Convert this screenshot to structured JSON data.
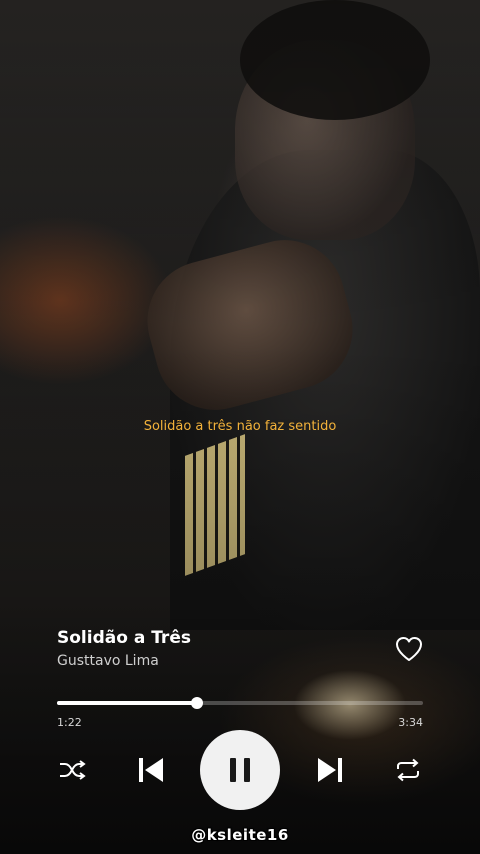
{
  "lyrics": {
    "current_line": "Solidão a três não faz sentido"
  },
  "track": {
    "title": "Solidão a Três",
    "artist": "Gusttavo Lima"
  },
  "playback": {
    "elapsed": "1:22",
    "duration": "3:34",
    "progress_fraction": 0.3832,
    "state": "playing"
  },
  "icons": {
    "like": "heart-outline-icon",
    "shuffle": "shuffle-icon",
    "previous": "skip-previous-icon",
    "play_pause": "pause-icon",
    "next": "skip-next-icon",
    "repeat": "repeat-icon"
  },
  "watermark": {
    "handle": "@ksleite16"
  },
  "colors": {
    "lyric": "#f3b23a",
    "play_button_bg": "#f1f1f1"
  }
}
